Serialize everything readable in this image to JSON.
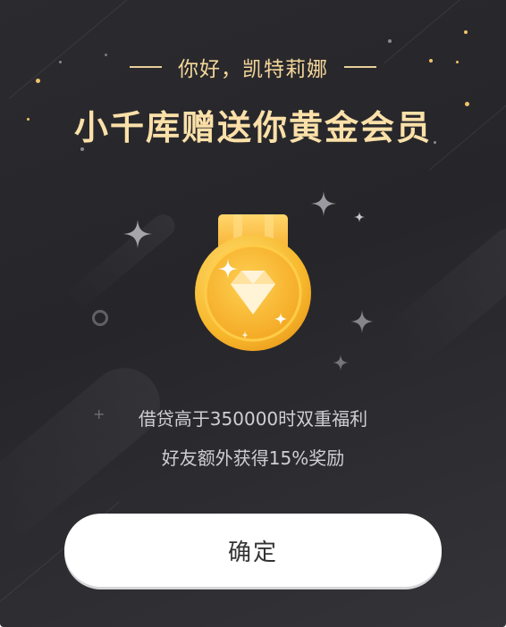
{
  "dialog": {
    "greeting": "你好，凯特莉娜",
    "title": "小千库赠送你黄金会员",
    "benefits": [
      "借贷高于350000时双重福利",
      "好友额外获得15%奖励"
    ],
    "confirm_label": "确定"
  },
  "colors": {
    "background": "#2a2a2e",
    "accent_gold": "#f5d79a",
    "medal_gold": "#f7b62c",
    "button_bg": "#ffffff"
  },
  "icons": {
    "medal": "gold-medal-diamond-icon",
    "sparkle": "four-point-star-icon",
    "ring": "circle-outline-icon",
    "plus": "plus-icon"
  }
}
